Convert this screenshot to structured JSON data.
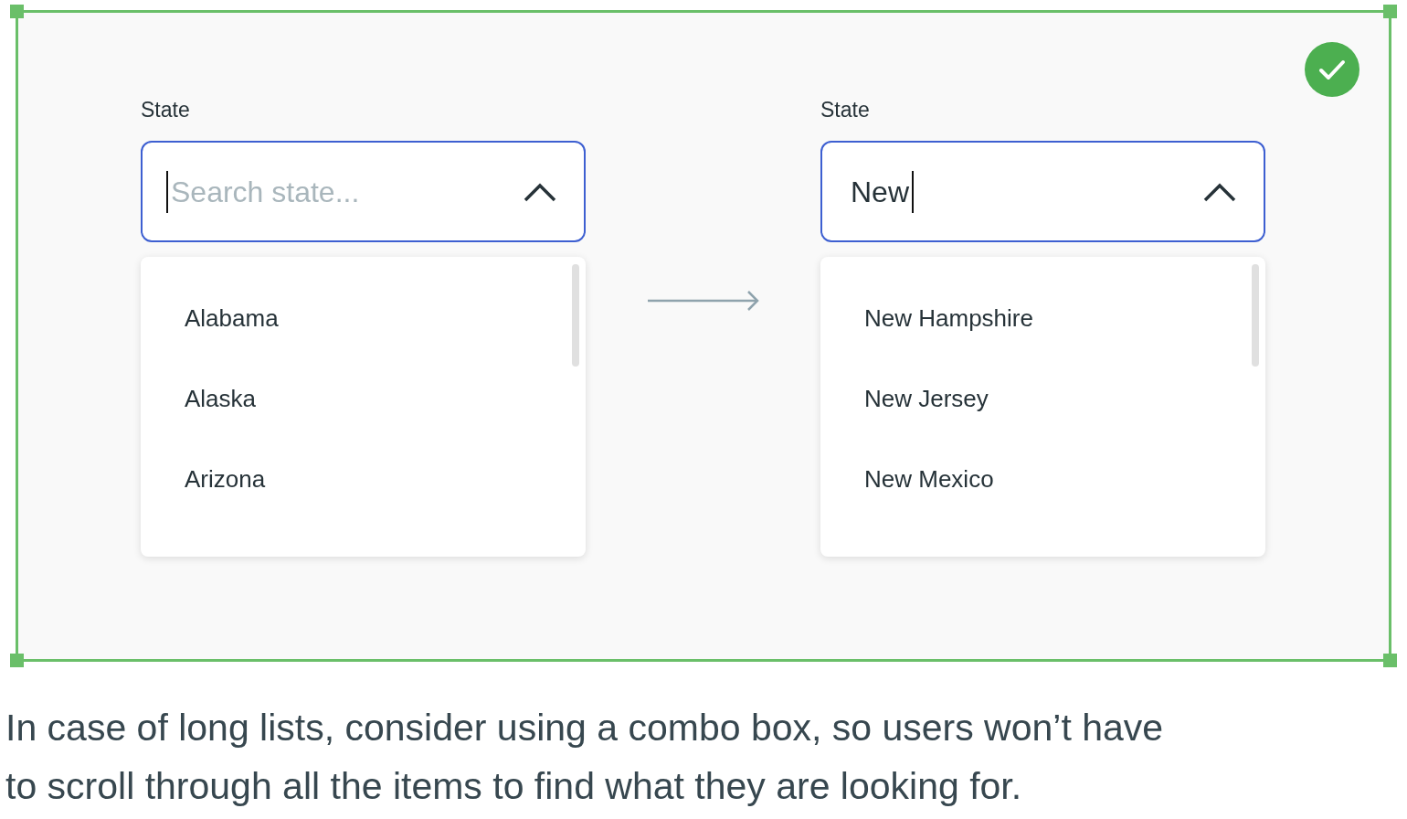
{
  "combos": [
    {
      "label": "State",
      "placeholder": "Search state...",
      "options": [
        "Alabama",
        "Alaska",
        "Arizona"
      ]
    },
    {
      "label": "State",
      "value": "New",
      "options": [
        "New Hampshire",
        "New Jersey",
        "New Mexico"
      ]
    }
  ],
  "caption": "In case of long lists, consider using a combo box, so users won’t have to scroll through all the items to find what they are looking for."
}
